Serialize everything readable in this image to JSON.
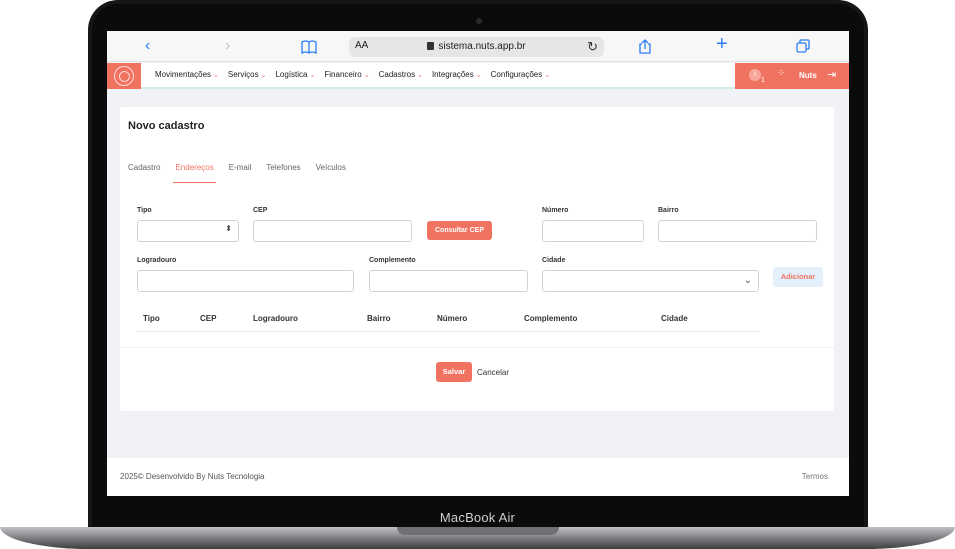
{
  "device": {
    "label": "MacBook Air"
  },
  "safari": {
    "text_size": "AA",
    "url": "sistema.nuts.app.br"
  },
  "nav": {
    "items": [
      {
        "label": "Movimentações"
      },
      {
        "label": "Serviços"
      },
      {
        "label": "Logística"
      },
      {
        "label": "Financeiro"
      },
      {
        "label": "Cadastros"
      },
      {
        "label": "Integrações"
      },
      {
        "label": "Configurações"
      }
    ],
    "caret": "⌄"
  },
  "user": {
    "notification_icon": "i",
    "notification_count": "1",
    "name": "Nuts"
  },
  "form": {
    "title": "Novo cadastro",
    "tabs": [
      {
        "label": "Cadastro"
      },
      {
        "label": "Endereços"
      },
      {
        "label": "E-mail"
      },
      {
        "label": "Telefones"
      },
      {
        "label": "Veículos"
      }
    ],
    "active_tab": "Endereços",
    "fields": {
      "tipo": {
        "label": "Tipo",
        "value": ""
      },
      "cep": {
        "label": "CEP",
        "value": ""
      },
      "numero": {
        "label": "Número",
        "value": ""
      },
      "bairro": {
        "label": "Bairro",
        "value": ""
      },
      "logradouro": {
        "label": "Logradouro",
        "value": ""
      },
      "complemento": {
        "label": "Complemento",
        "value": ""
      },
      "cidade": {
        "label": "Cidade",
        "value": ""
      }
    },
    "consult_cep_label": "Consultar CEP",
    "add_label": "Adicionar",
    "table_headers": [
      "Tipo",
      "CEP",
      "Logradouro",
      "Bairro",
      "Número",
      "Complemento",
      "Cidade"
    ],
    "save_label": "Salvar",
    "cancel_label": "Cancelar"
  },
  "footer": {
    "copyright": "2025© Desenvolvido By Nuts Tecnologia",
    "terms": "Termos"
  },
  "colors": {
    "accent": "#f07362",
    "add_button_bg": "#e3f0fb",
    "page_bg": "#f1f2f5"
  },
  "icons": {
    "back": "chevron-left-icon",
    "forward": "chevron-right-icon",
    "bookmarks": "book-icon",
    "lock": "lock-icon",
    "reload": "reload-icon",
    "share": "share-icon",
    "new_tab": "plus-icon",
    "tabs": "tabs-icon",
    "logo": "nuts-logo-icon",
    "notification": "info-icon",
    "apps": "diamond-dots-icon",
    "logout": "logout-icon"
  }
}
